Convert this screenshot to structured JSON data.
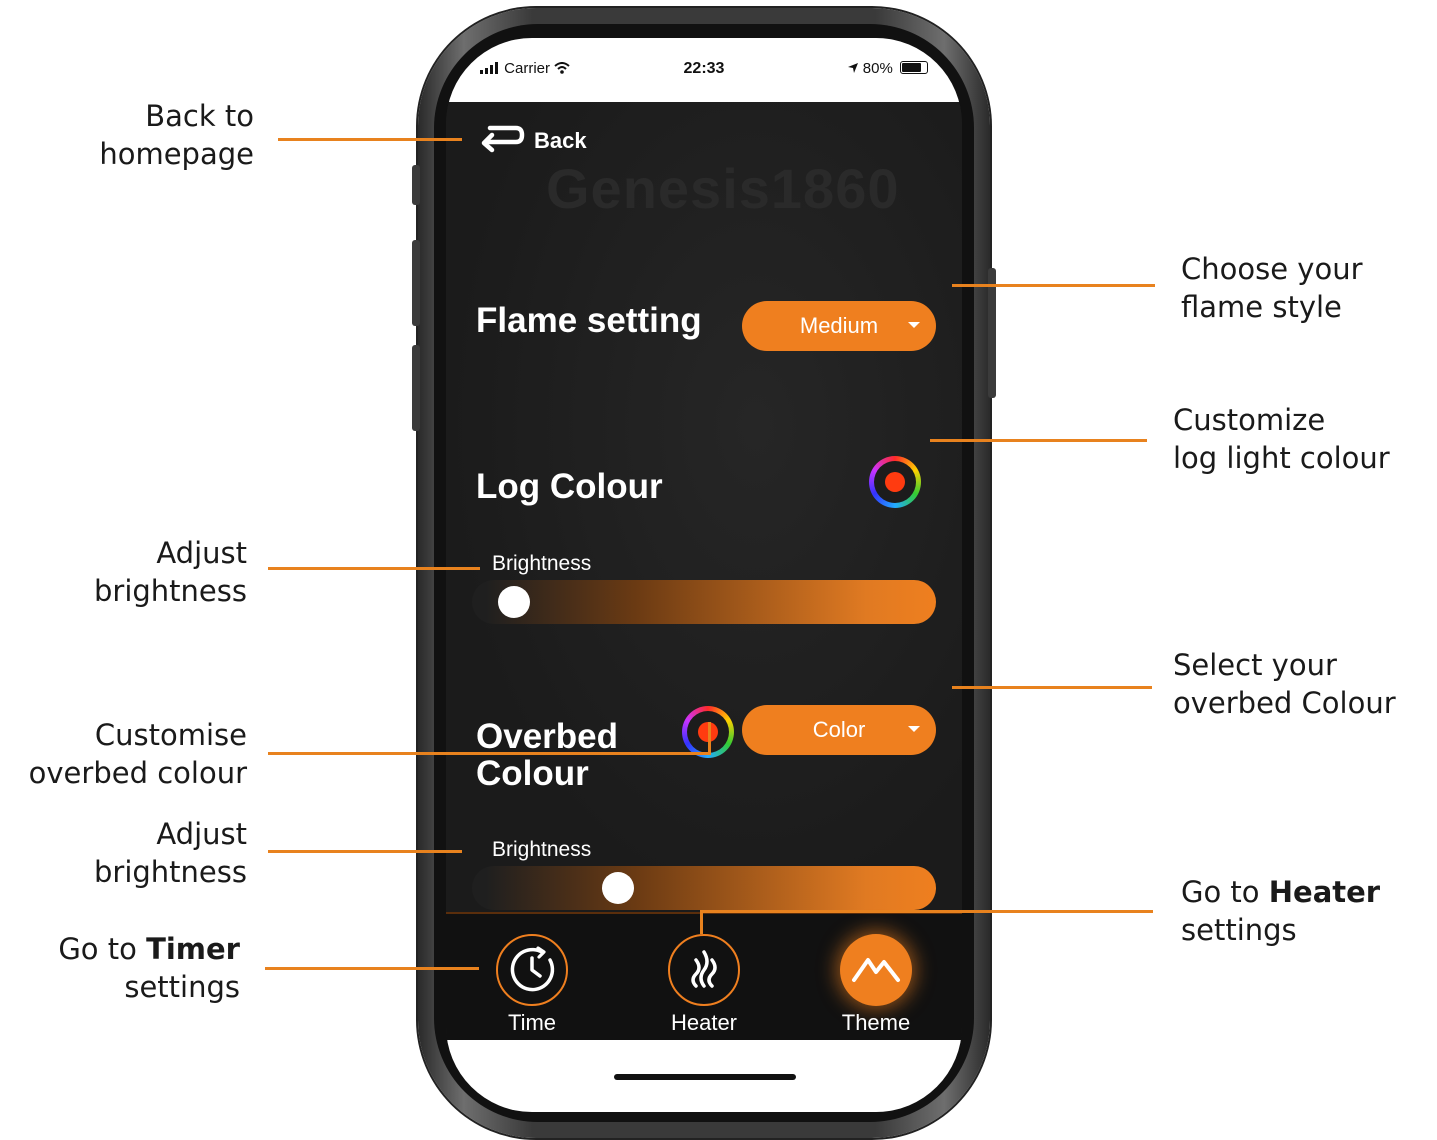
{
  "status_bar": {
    "carrier": "Carrier",
    "time": "22:33",
    "battery": "80%"
  },
  "header": {
    "back_label": "Back",
    "brand": "Genesis1860"
  },
  "flame": {
    "label": "Flame setting",
    "value": "Medium"
  },
  "log": {
    "label": "Log Colour",
    "brightness_label": "Brightness",
    "brightness": 0.06,
    "dot_color": "#ff3b10"
  },
  "overbed": {
    "label_line1": "Overbed",
    "label_line2": "Colour",
    "value": "Color",
    "brightness_label": "Brightness",
    "brightness": 0.3,
    "dot_color": "#ff3b10"
  },
  "tabs": [
    {
      "label": "Time",
      "icon": "clock-icon"
    },
    {
      "label": "Heater",
      "icon": "heat-waves-icon"
    },
    {
      "label": "Theme",
      "icon": "mountain-icon",
      "active": true
    }
  ],
  "annotations": {
    "back": {
      "line1": "Back to",
      "line2": "homepage"
    },
    "flame": {
      "line1": "Choose your",
      "line2": "flame style"
    },
    "log_colour": {
      "line1": "Customize",
      "line2": "log light colour"
    },
    "brightness1": {
      "line1": "Adjust",
      "line2": "brightness"
    },
    "overbed_select": {
      "line1": "Select your",
      "line2": "overbed Colour"
    },
    "overbed_custom": {
      "line1": "Customise",
      "line2": "overbed colour"
    },
    "brightness2": {
      "line1": "Adjust",
      "line2": "brightness"
    },
    "timer": {
      "pre": "Go to ",
      "bold": "Timer",
      "line2": "settings"
    },
    "heater": {
      "pre": "Go to ",
      "bold": "Heater",
      "line2": "settings"
    }
  },
  "colors": {
    "accent": "#ef7f1f",
    "annotation_line": "#e8821e",
    "background": "#1e1e1e"
  }
}
